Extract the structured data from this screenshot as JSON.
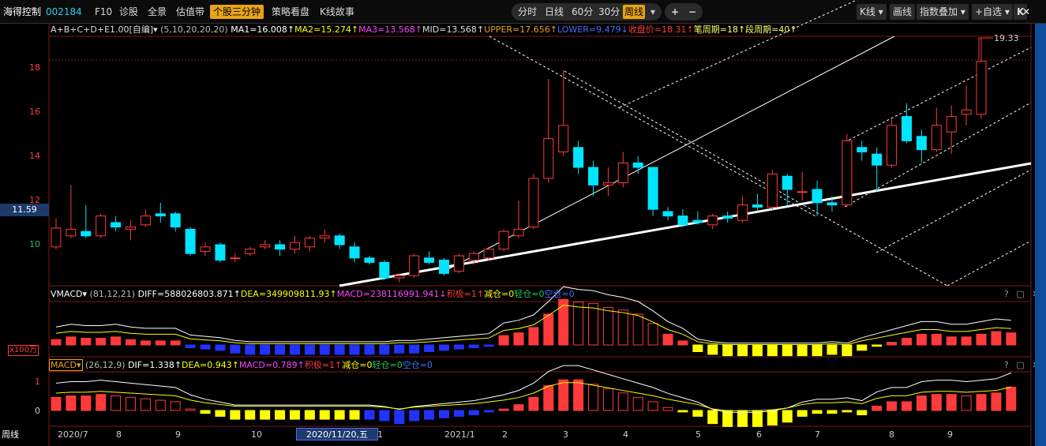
{
  "toolbar": {
    "stock_name": "海得控制",
    "stock_code": "002184",
    "items": [
      "F10",
      "诊股",
      "全景",
      "估值带"
    ],
    "active": "个股三分钟",
    "items2": [
      "策略看盘",
      "K线故事"
    ],
    "periods": [
      "分时",
      "日线",
      "60分",
      "30分"
    ],
    "period_active": "周线",
    "plus": "+",
    "minus": "−",
    "kline": "K线 ▾",
    "draw": "画线",
    "indicator": "指数叠加 ▾",
    "watch": "+自选 ▾",
    "k": "K",
    "close_x": "✕"
  },
  "main_info": {
    "formula": "A+B+C+D+E1.00[自编]▾",
    "params": "(5,10,20,20,20)",
    "ma1": "MA1=16.008↑",
    "ma2": "MA2=15.274↑",
    "ma3": "MA3=13.568↑",
    "mid": "MID=13.568↑",
    "upper": "UPPER=17.656↑",
    "lower": "LOWER=9.479↓",
    "close": "收盘价=18.31↑",
    "bi": "笔周期=18↑",
    "duan": "段周期=40↑"
  },
  "price_axis": [
    "18",
    "16",
    "14",
    "12",
    "10"
  ],
  "price_marker": "11.59",
  "max_label": "19.33",
  "vmacd": {
    "name": "VMACD▾",
    "params": "(81,12,21)",
    "diff": "DIFF=588026803.871↑",
    "dea": "DEA=349909811.93↑",
    "macd": "MACD=238116991.941↓",
    "jiji": "积极=1↑",
    "jiancang": "减仓=0",
    "qingcang": "轻仓=0",
    "kongcang": "空仓=0",
    "unit": "x100万"
  },
  "macd": {
    "name": "MACD▾",
    "params": "(26,12,9)",
    "dif": "DIF=1.338↑",
    "dea": "DEA=0.943↑",
    "macd": "MACD=0.789↑",
    "jiji": "积极=1↑",
    "jiancang": "减仓=0",
    "qingcang": "轻仓=0",
    "kongcang": "空仓=0",
    "axis_top": "1",
    "axis_zero": "0"
  },
  "panel_controls": "? ▢ ✕",
  "date_axis": {
    "period": "周线",
    "labels": [
      "2020/7",
      "8",
      "9",
      "10",
      "1",
      "2021/1",
      "2",
      "3",
      "4",
      "5",
      "6",
      "7",
      "8",
      "9"
    ],
    "cursor": "2020/11/20,五"
  },
  "colors": {
    "up": "#ff3a3a",
    "down": "#00e5ff",
    "yellow": "#ffff00",
    "blue": "#2233ff",
    "accent": "#e8a317",
    "side": "#0e4d9a"
  },
  "chart_data": {
    "type": "candlestick",
    "ylim": [
      8,
      19.5
    ],
    "candles": [
      {
        "o": 9.9,
        "c": 10.75,
        "h": 11.2,
        "l": 9.8
      },
      {
        "o": 10.4,
        "c": 10.7,
        "h": 12.7,
        "l": 10.3
      },
      {
        "o": 10.6,
        "c": 10.4,
        "h": 11.8,
        "l": 10.3
      },
      {
        "o": 10.4,
        "c": 11.3,
        "h": 11.4,
        "l": 10.3
      },
      {
        "o": 11.0,
        "c": 10.8,
        "h": 11.3,
        "l": 10.6
      },
      {
        "o": 10.7,
        "c": 10.8,
        "h": 11.1,
        "l": 10.2
      },
      {
        "o": 10.9,
        "c": 11.3,
        "h": 11.6,
        "l": 10.8
      },
      {
        "o": 11.4,
        "c": 11.3,
        "h": 11.9,
        "l": 11.0
      },
      {
        "o": 11.4,
        "c": 10.8,
        "h": 11.5,
        "l": 10.6
      },
      {
        "o": 10.7,
        "c": 9.6,
        "h": 10.8,
        "l": 9.5
      },
      {
        "o": 9.7,
        "c": 9.9,
        "h": 10.1,
        "l": 9.5
      },
      {
        "o": 10.0,
        "c": 9.3,
        "h": 10.1,
        "l": 9.2
      },
      {
        "o": 9.4,
        "c": 9.4,
        "h": 9.6,
        "l": 9.2
      },
      {
        "o": 9.6,
        "c": 9.8,
        "h": 9.9,
        "l": 9.5
      },
      {
        "o": 9.9,
        "c": 10.0,
        "h": 10.2,
        "l": 9.8
      },
      {
        "o": 10.0,
        "c": 9.8,
        "h": 10.2,
        "l": 9.5
      },
      {
        "o": 9.8,
        "c": 10.1,
        "h": 10.4,
        "l": 9.6
      },
      {
        "o": 9.9,
        "c": 10.3,
        "h": 10.4,
        "l": 9.7
      },
      {
        "o": 10.3,
        "c": 10.4,
        "h": 10.7,
        "l": 10.1
      },
      {
        "o": 10.4,
        "c": 10.0,
        "h": 10.5,
        "l": 9.8
      },
      {
        "o": 9.9,
        "c": 9.4,
        "h": 10.1,
        "l": 9.2
      },
      {
        "o": 9.4,
        "c": 9.2,
        "h": 9.5,
        "l": 9.1
      },
      {
        "o": 9.2,
        "c": 8.5,
        "h": 9.3,
        "l": 8.4
      },
      {
        "o": 8.5,
        "c": 8.6,
        "h": 8.7,
        "l": 8.3
      },
      {
        "o": 8.6,
        "c": 9.5,
        "h": 9.6,
        "l": 8.5
      },
      {
        "o": 9.4,
        "c": 9.2,
        "h": 9.7,
        "l": 9.1
      },
      {
        "o": 9.3,
        "c": 8.7,
        "h": 9.4,
        "l": 8.6
      },
      {
        "o": 8.8,
        "c": 9.5,
        "h": 9.6,
        "l": 8.7
      },
      {
        "o": 9.3,
        "c": 9.6,
        "h": 9.7,
        "l": 9.1
      },
      {
        "o": 9.4,
        "c": 9.8,
        "h": 9.9,
        "l": 9.3
      },
      {
        "o": 9.8,
        "c": 10.6,
        "h": 10.7,
        "l": 9.7
      },
      {
        "o": 10.4,
        "c": 10.7,
        "h": 12.0,
        "l": 10.3
      },
      {
        "o": 10.8,
        "c": 13.0,
        "h": 13.2,
        "l": 10.7
      },
      {
        "o": 13.0,
        "c": 14.8,
        "h": 17.5,
        "l": 12.8
      },
      {
        "o": 14.2,
        "c": 15.4,
        "h": 17.9,
        "l": 14.0
      },
      {
        "o": 14.4,
        "c": 13.5,
        "h": 14.7,
        "l": 13.2
      },
      {
        "o": 13.5,
        "c": 12.7,
        "h": 13.8,
        "l": 12.2
      },
      {
        "o": 12.7,
        "c": 12.8,
        "h": 13.5,
        "l": 12.2
      },
      {
        "o": 12.8,
        "c": 13.7,
        "h": 14.2,
        "l": 12.6
      },
      {
        "o": 13.7,
        "c": 13.5,
        "h": 14.0,
        "l": 13.2
      },
      {
        "o": 13.5,
        "c": 11.6,
        "h": 13.5,
        "l": 11.3
      },
      {
        "o": 11.5,
        "c": 11.3,
        "h": 11.7,
        "l": 11.1
      },
      {
        "o": 11.3,
        "c": 10.9,
        "h": 11.6,
        "l": 10.8
      },
      {
        "o": 11.1,
        "c": 11.0,
        "h": 11.5,
        "l": 10.9
      },
      {
        "o": 10.9,
        "c": 11.3,
        "h": 11.4,
        "l": 10.7
      },
      {
        "o": 11.3,
        "c": 11.2,
        "h": 11.5,
        "l": 11.0
      },
      {
        "o": 11.1,
        "c": 11.8,
        "h": 12.2,
        "l": 11.0
      },
      {
        "o": 11.8,
        "c": 11.7,
        "h": 12.3,
        "l": 11.5
      },
      {
        "o": 11.7,
        "c": 13.2,
        "h": 13.4,
        "l": 11.6
      },
      {
        "o": 13.1,
        "c": 12.5,
        "h": 13.2,
        "l": 11.8
      },
      {
        "o": 12.4,
        "c": 12.4,
        "h": 13.3,
        "l": 12.0
      },
      {
        "o": 12.5,
        "c": 11.9,
        "h": 12.9,
        "l": 11.3
      },
      {
        "o": 11.9,
        "c": 11.8,
        "h": 12.2,
        "l": 11.5
      },
      {
        "o": 11.8,
        "c": 14.7,
        "h": 15.0,
        "l": 11.7
      },
      {
        "o": 14.4,
        "c": 14.2,
        "h": 14.7,
        "l": 13.8
      },
      {
        "o": 14.1,
        "c": 13.6,
        "h": 14.4,
        "l": 12.4
      },
      {
        "o": 13.6,
        "c": 15.4,
        "h": 15.7,
        "l": 13.5
      },
      {
        "o": 15.8,
        "c": 14.7,
        "h": 16.4,
        "l": 14.6
      },
      {
        "o": 14.9,
        "c": 14.3,
        "h": 15.2,
        "l": 13.7
      },
      {
        "o": 14.3,
        "c": 15.4,
        "h": 16.2,
        "l": 14.2
      },
      {
        "o": 15.1,
        "c": 15.8,
        "h": 16.3,
        "l": 14.1
      },
      {
        "o": 15.9,
        "c": 16.1,
        "h": 17.2,
        "l": 15.4
      },
      {
        "o": 15.9,
        "c": 18.3,
        "h": 19.33,
        "l": 15.7
      }
    ],
    "vmacd_hist": [
      0.4,
      0.6,
      0.5,
      0.5,
      0.6,
      0.4,
      0.3,
      0.3,
      0.3,
      -0.2,
      -0.3,
      -0.4,
      -0.6,
      -0.7,
      -0.7,
      -0.7,
      -0.7,
      -0.7,
      -0.7,
      -0.7,
      -0.7,
      -0.7,
      -0.7,
      -0.6,
      -0.6,
      -0.5,
      -0.4,
      -0.3,
      -0.2,
      -0.1,
      0.7,
      0.9,
      1.3,
      2.3,
      3.4,
      3.2,
      3.1,
      2.8,
      2.6,
      2.3,
      1.6,
      0.8,
      0.3,
      -0.5,
      -0.7,
      -0.8,
      -0.8,
      -0.8,
      -0.8,
      -0.8,
      -0.8,
      -0.8,
      -0.7,
      -0.8,
      -0.4,
      -0.1,
      0.2,
      0.5,
      0.8,
      0.8,
      0.6,
      0.6,
      0.8,
      1.0,
      0.9
    ],
    "macd_hist": [
      0.45,
      0.5,
      0.5,
      0.55,
      0.5,
      0.45,
      0.4,
      0.35,
      0.3,
      0.05,
      -0.1,
      -0.2,
      -0.3,
      -0.3,
      -0.3,
      -0.3,
      -0.3,
      -0.3,
      -0.3,
      -0.3,
      -0.3,
      -0.3,
      -0.35,
      -0.45,
      -0.35,
      -0.3,
      -0.25,
      -0.2,
      -0.15,
      -0.05,
      0.05,
      0.2,
      0.45,
      0.85,
      1.05,
      1.05,
      0.9,
      0.75,
      0.6,
      0.45,
      0.3,
      0.1,
      -0.05,
      -0.2,
      -0.45,
      -0.55,
      -0.55,
      -0.55,
      -0.5,
      -0.4,
      -0.2,
      -0.1,
      -0.1,
      -0.05,
      -0.15,
      0.15,
      0.3,
      0.3,
      0.5,
      0.55,
      0.55,
      0.5,
      0.55,
      0.6,
      0.8
    ]
  }
}
